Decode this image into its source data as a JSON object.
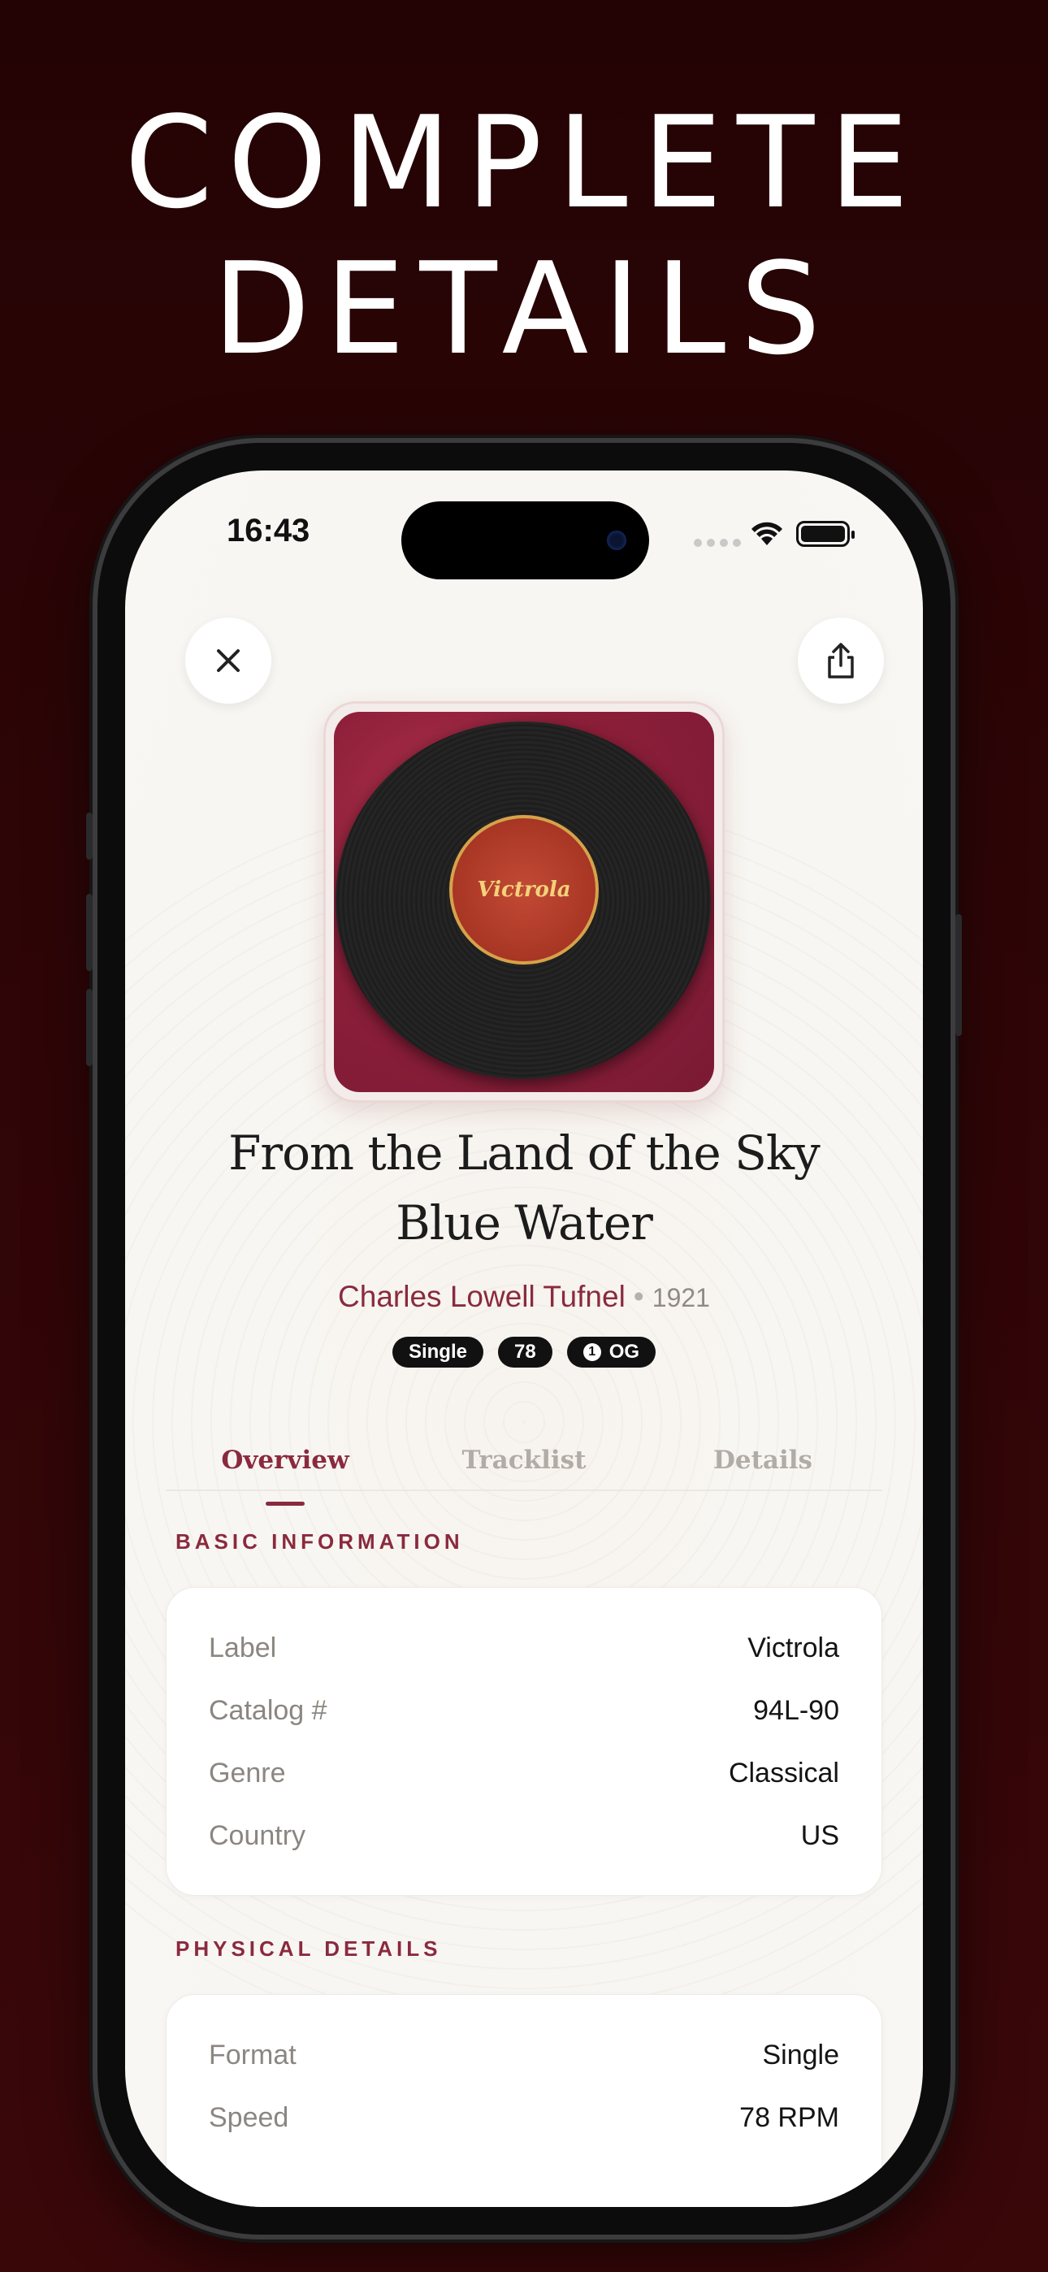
{
  "promo": {
    "line1": "COMPLETE",
    "line2": "DETAILS"
  },
  "status_bar": {
    "time": "16:43"
  },
  "toolbar": {
    "close_icon": "close-icon",
    "share_icon": "share-icon"
  },
  "record": {
    "cover_label_text": "Victrola",
    "title": "From the Land of the Sky Blue Water",
    "artist": "Charles Lowell Tufnel",
    "separator": "•",
    "year": "1921",
    "tags": [
      {
        "label": "Single"
      },
      {
        "label": "78"
      },
      {
        "badge_num": "1",
        "label": "OG"
      }
    ]
  },
  "tabs": [
    {
      "label": "Overview",
      "active": true
    },
    {
      "label": "Tracklist",
      "active": false
    },
    {
      "label": "Details",
      "active": false
    }
  ],
  "basic_info": {
    "title": "BASIC INFORMATION",
    "rows": [
      {
        "key": "Label",
        "value": "Victrola"
      },
      {
        "key": "Catalog #",
        "value": "94L-90"
      },
      {
        "key": "Genre",
        "value": "Classical"
      },
      {
        "key": "Country",
        "value": "US"
      }
    ]
  },
  "physical_details": {
    "title": "PHYSICAL DETAILS",
    "rows": [
      {
        "key": "Format",
        "value": "Single"
      },
      {
        "key": "Speed",
        "value": "78 RPM"
      }
    ]
  },
  "colors": {
    "accent": "#8a2a3e",
    "background": "#2e0507",
    "screen": "#f8f6f2"
  }
}
